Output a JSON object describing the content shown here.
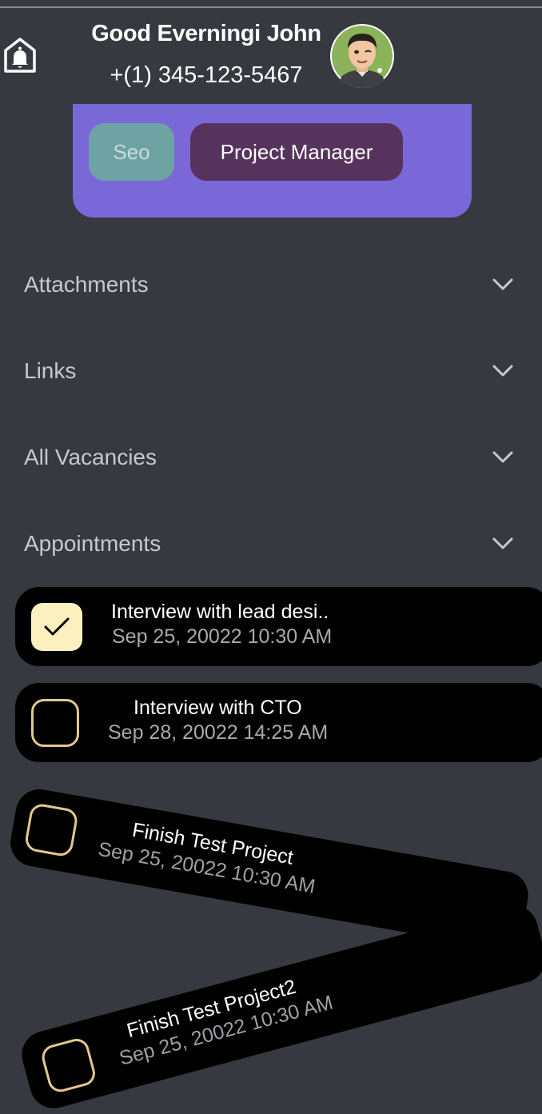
{
  "header": {
    "greeting": "Good Everningi John",
    "phone": "+(1) 345-123-5467",
    "notification_icon": "bell-icon",
    "avatar_icon": "avatar-cartoon"
  },
  "roles": {
    "chips": [
      "Seo",
      "Project Manager"
    ]
  },
  "sections": [
    {
      "label": "Attachments"
    },
    {
      "label": "Links"
    },
    {
      "label": "All Vacancies"
    },
    {
      "label": "Appointments"
    }
  ],
  "appointments": [
    {
      "title": "Interview with lead desi..",
      "date": "Sep 25, 20022 10:30 AM",
      "checked": true
    },
    {
      "title": "Interview with CTO",
      "date": "Sep 28, 20022 14:25 AM",
      "checked": false
    },
    {
      "title": "Finish Test Project",
      "date": "Sep 25, 20022 10:30 AM",
      "checked": false
    },
    {
      "title": "Finish Test Project2",
      "date": "Sep 25, 20022 10:30 AM",
      "checked": false
    }
  ],
  "colors": {
    "background": "#36393f",
    "card": "#7b68d8",
    "chip_seo": "#6fa3a3",
    "chip_pm": "#56335c",
    "checkbox_border": "#e3c98a",
    "checkbox_checked": "#fdf0bf"
  }
}
